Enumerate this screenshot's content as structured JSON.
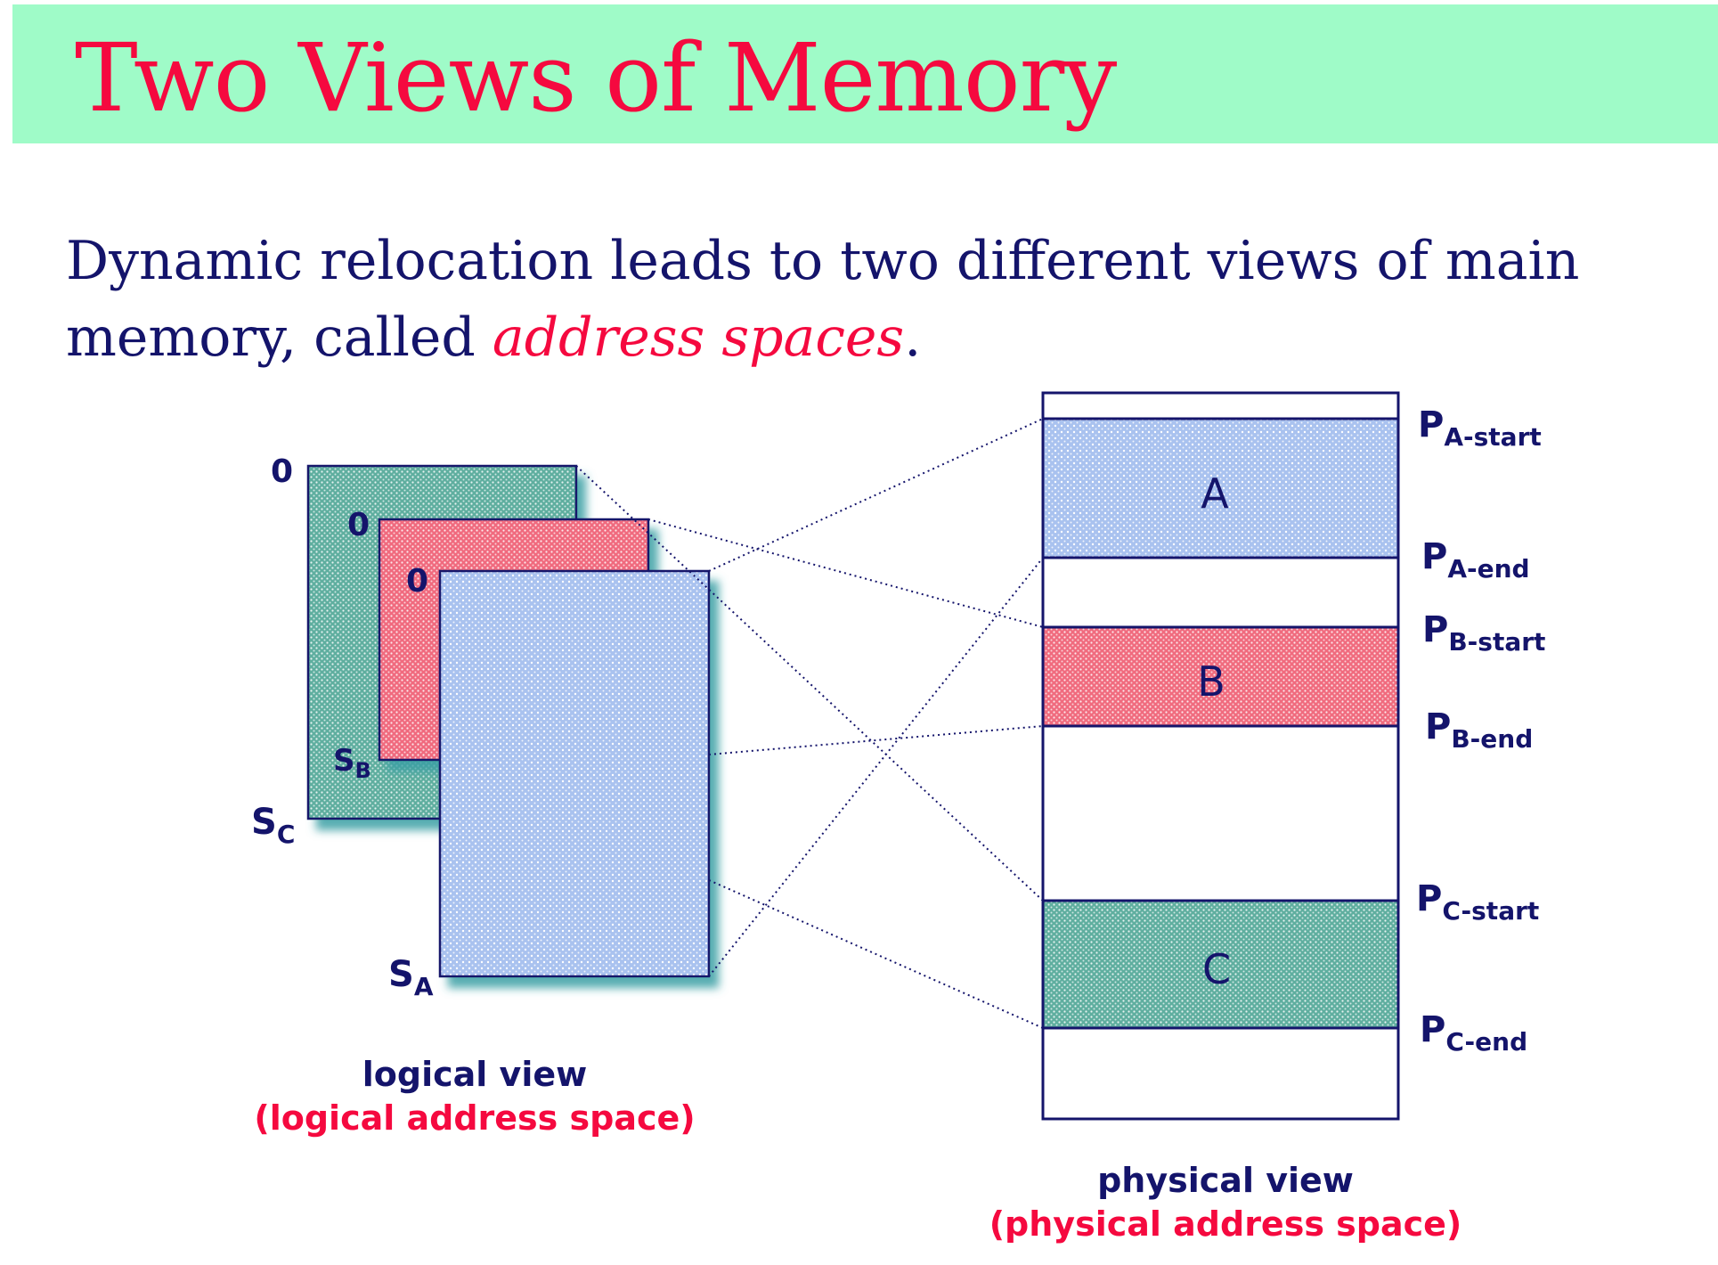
{
  "title": "Two Views of Memory",
  "intro": {
    "text_before": "Dynamic relocation leads to two different views of main memory, called ",
    "emphasis": "address spaces",
    "text_after": "."
  },
  "colors": {
    "banner": "#9ffbc8",
    "title": "#f5093f",
    "navy": "#14146b",
    "red_label": "#f5093f",
    "block_a": "#a9c2ef",
    "block_b": "#f06b7e",
    "block_c": "#5fae9f"
  },
  "logical": {
    "zero_labels": [
      "0",
      "0",
      "0"
    ],
    "size_labels": {
      "c": {
        "main": "S",
        "sub": "C"
      },
      "b": {
        "main": "S",
        "sub": "B"
      },
      "a": {
        "main": "S",
        "sub": "A"
      }
    },
    "caption": "logical view",
    "subcaption": "(logical address space)"
  },
  "physical": {
    "blocks": [
      {
        "id": "A",
        "label": "A",
        "start": {
          "main": "P",
          "sub": "A-start"
        },
        "end": {
          "main": "P",
          "sub": "A-end"
        }
      },
      {
        "id": "B",
        "label": "B",
        "start": {
          "main": "P",
          "sub": "B-start"
        },
        "end": {
          "main": "P",
          "sub": "B-end"
        }
      },
      {
        "id": "C",
        "label": "C",
        "start": {
          "main": "P",
          "sub": "C-start"
        },
        "end": {
          "main": "P",
          "sub": "C-end"
        }
      }
    ],
    "caption": "physical view",
    "subcaption": "(physical address space)"
  }
}
